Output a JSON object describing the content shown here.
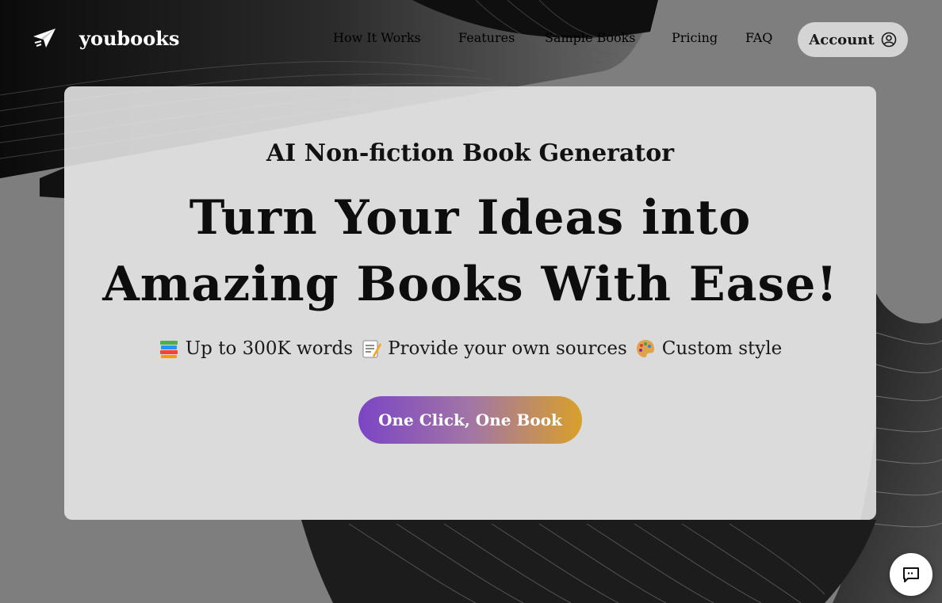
{
  "brand": {
    "name": "youbooks",
    "logo_icon": "paper-plane-icon"
  },
  "nav": {
    "items": [
      {
        "label": "How It Works"
      },
      {
        "label": "Features"
      },
      {
        "label": "Sample Books"
      },
      {
        "label": "Pricing"
      },
      {
        "label": "FAQ"
      }
    ],
    "account_label": "Account",
    "account_icon": "user-circle-icon"
  },
  "hero": {
    "subtitle": "AI Non-fiction Book Generator",
    "title_line1": "Turn Your Ideas into",
    "title_line2": "Amazing Books With Ease!",
    "features": [
      {
        "icon": "books-icon",
        "text": "Up to 300K words"
      },
      {
        "icon": "memo-icon",
        "text": "Provide your own sources"
      },
      {
        "icon": "palette-icon",
        "text": "Custom style"
      }
    ],
    "cta_label": "One Click, One Book"
  },
  "chat": {
    "icon": "chat-bubble-icon"
  },
  "colors": {
    "cta_start": "#7b45c4",
    "cta_end": "#d9a02a",
    "card_bg": "#e6e6e6"
  }
}
